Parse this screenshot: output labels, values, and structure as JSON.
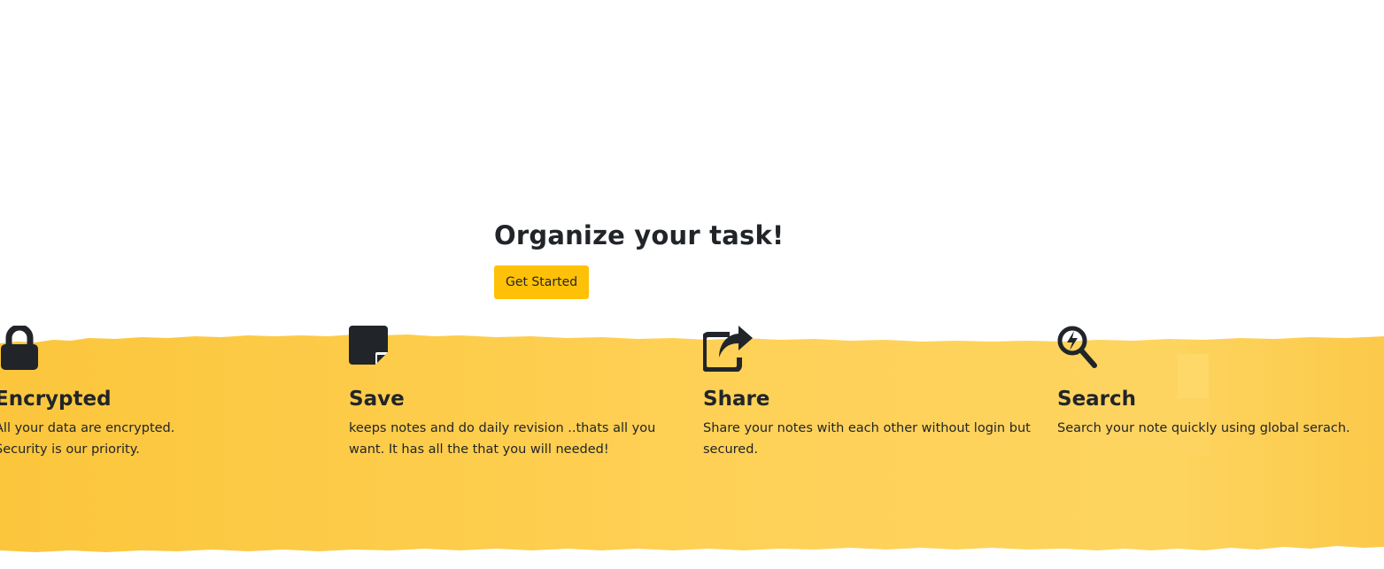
{
  "hero": {
    "title": "Organize your task!",
    "button_label": "Get Started"
  },
  "features": [
    {
      "icon": "lock-icon",
      "title": "Encrypted",
      "desc_line1": "All your data are encrypted.",
      "desc_line2": "Security is our priority."
    },
    {
      "icon": "sticky-note-icon",
      "title": "Save",
      "desc_line1": "keeps notes and do daily revision ..thats all you",
      "desc_line2": "want. It has all the that you will needed!"
    },
    {
      "icon": "share-icon",
      "title": "Share",
      "desc_line1": "Share your notes with each other without login but",
      "desc_line2": "secured."
    },
    {
      "icon": "search-bolt-icon",
      "title": "Search",
      "desc_line1": "Search your note quickly using global serach.",
      "desc_line2": ""
    }
  ],
  "colors": {
    "accent": "#ffc107",
    "band": "#fdcb45",
    "text": "#212529"
  }
}
